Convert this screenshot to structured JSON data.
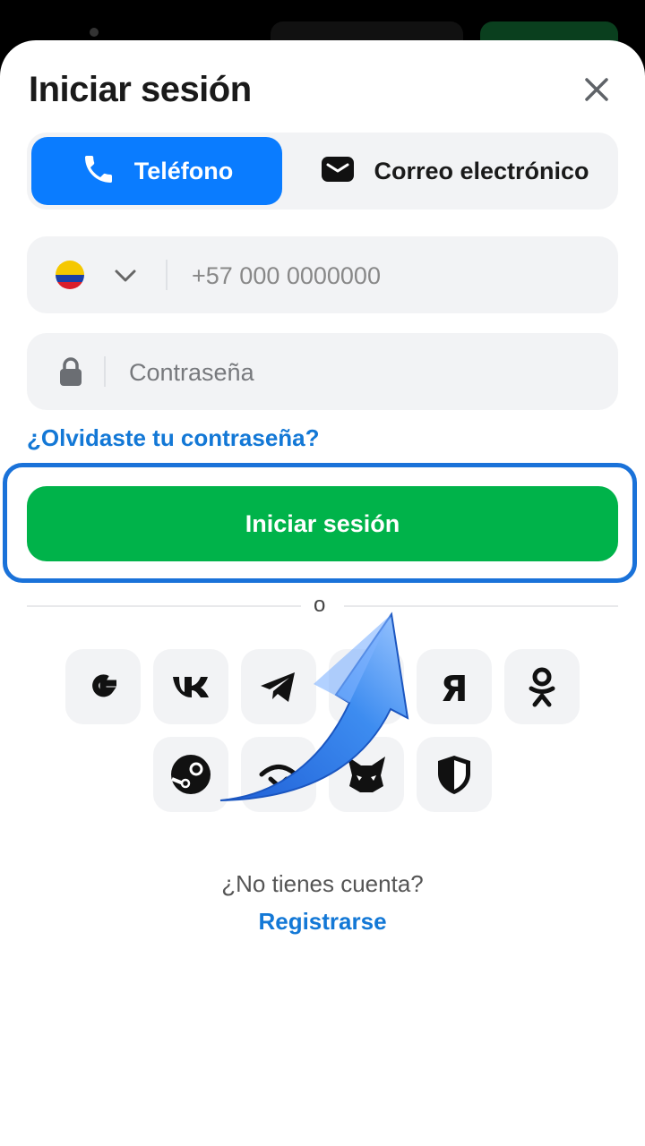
{
  "header": {
    "title": "Iniciar sesión"
  },
  "tabs": [
    {
      "label": "Teléfono",
      "icon": "phone-icon",
      "active": true
    },
    {
      "label": "Correo electrónico",
      "icon": "email-icon",
      "active": false
    }
  ],
  "phone_field": {
    "country_flag": "colombia-flag-icon",
    "placeholder": "+57 000 0000000"
  },
  "password_field": {
    "placeholder": "Contraseña"
  },
  "forgot_password": "¿Olvidaste tu contraseña?",
  "login_button": "Iniciar sesión",
  "divider_text": "o",
  "social_logins": [
    {
      "name": "google",
      "icon": "google-icon"
    },
    {
      "name": "vk",
      "icon": "vk-icon"
    },
    {
      "name": "telegram",
      "icon": "telegram-icon"
    },
    {
      "name": "mail-ru",
      "icon": "mailru-icon"
    },
    {
      "name": "yandex",
      "icon": "yandex-icon"
    },
    {
      "name": "odnoklassniki",
      "icon": "ok-icon"
    },
    {
      "name": "steam",
      "icon": "steam-icon"
    },
    {
      "name": "wallet",
      "icon": "wallet-icon"
    },
    {
      "name": "metamask",
      "icon": "metamask-icon"
    },
    {
      "name": "security",
      "icon": "shield-icon"
    }
  ],
  "footer": {
    "no_account_text": "¿No tienes cuenta?",
    "register_link": "Registrarse"
  },
  "colors": {
    "primary_blue": "#0a7cff",
    "action_green": "#00b34a",
    "link_blue": "#1378d6",
    "highlight_outline": "#1a72d9"
  }
}
